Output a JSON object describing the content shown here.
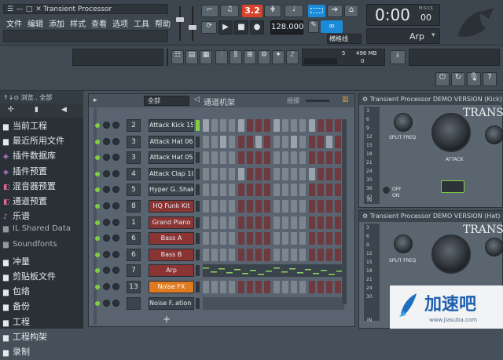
{
  "window": {
    "title": "Transient Processor",
    "buttons": [
      "☰",
      "—",
      "□",
      "✕"
    ]
  },
  "menu": [
    "文件",
    "编辑",
    "添加",
    "样式",
    "查看",
    "选项",
    "工具",
    "帮助"
  ],
  "transport": {
    "pattern_number": "3.2",
    "tempo": "128.000",
    "time": "0:00",
    "time_small": "00",
    "time_unit": "M:S:CS",
    "instrument": "Arp",
    "snap": "横格线"
  },
  "monitor": {
    "value": "5",
    "memory": "496 MB",
    "cpu": "0"
  },
  "browser": {
    "header": "浏览.. 全部",
    "items": [
      {
        "icon": "folder-icon",
        "label": "当前工程",
        "type": "folder"
      },
      {
        "icon": "folder-icon",
        "label": "最近所用文件",
        "type": "folder"
      },
      {
        "icon": "plugin-icon",
        "label": "插件数据库",
        "type": "plugin"
      },
      {
        "icon": "plugin-icon",
        "label": "插件预置",
        "type": "plugin"
      },
      {
        "icon": "mixer-icon",
        "label": "混音器预置",
        "type": "mixer"
      },
      {
        "icon": "channel-icon",
        "label": "通道预置",
        "type": "channel"
      },
      {
        "icon": "note-icon",
        "label": "乐谱",
        "type": "note"
      },
      {
        "icon": "folder-icon",
        "label": "IL Shared Data",
        "type": "folder-dim"
      },
      {
        "icon": "folder-icon",
        "label": "Soundfonts",
        "type": "folder-dim"
      },
      {
        "icon": "folder-icon",
        "label": "冲量",
        "type": "folder"
      },
      {
        "icon": "folder-icon",
        "label": "剪贴板文件",
        "type": "folder"
      },
      {
        "icon": "folder-icon",
        "label": "包络",
        "type": "folder"
      },
      {
        "icon": "folder-icon",
        "label": "备份",
        "type": "folder"
      },
      {
        "icon": "folder-icon",
        "label": "工程",
        "type": "folder"
      },
      {
        "icon": "folder-icon",
        "label": "工程构架",
        "type": "folder"
      },
      {
        "icon": "folder-icon",
        "label": "录制",
        "type": "folder"
      }
    ]
  },
  "channel_rack": {
    "filter": "全部",
    "title": "通道机架",
    "swing_label": "摇摆",
    "add_label": "+",
    "channels": [
      {
        "num": "2",
        "name": "Attack Kick 15",
        "style": "normal",
        "steps": [
          1,
          0,
          0,
          0,
          1,
          0,
          0,
          0,
          1,
          0,
          0,
          0,
          1,
          0,
          0,
          0
        ]
      },
      {
        "num": "3",
        "name": "Attack Hat 06",
        "style": "normal",
        "steps": [
          0,
          0,
          1,
          0,
          0,
          0,
          1,
          0,
          0,
          0,
          1,
          0,
          0,
          0,
          1,
          0
        ]
      },
      {
        "num": "3",
        "name": "Attack Hat 05",
        "style": "normal",
        "steps": [
          0,
          0,
          0,
          0,
          0,
          0,
          0,
          0,
          0,
          0,
          0,
          0,
          0,
          0,
          0,
          0
        ]
      },
      {
        "num": "4",
        "name": "Attack Clap 10",
        "style": "normal",
        "steps": [
          0,
          0,
          0,
          0,
          1,
          0,
          0,
          0,
          0,
          0,
          0,
          0,
          1,
          0,
          0,
          0
        ]
      },
      {
        "num": "5",
        "name": "Hyper G..Shaker",
        "style": "normal",
        "steps": [
          0,
          0,
          0,
          0,
          0,
          0,
          0,
          0,
          0,
          0,
          0,
          0,
          0,
          0,
          0,
          0
        ]
      },
      {
        "num": "8",
        "name": "HQ Funk Kit",
        "style": "red",
        "steps": [
          0,
          0,
          0,
          0,
          0,
          0,
          0,
          0,
          0,
          0,
          0,
          0,
          0,
          0,
          0,
          0
        ]
      },
      {
        "num": "1",
        "name": "Grand Piano",
        "style": "red",
        "steps": [
          0,
          0,
          0,
          0,
          0,
          0,
          0,
          0,
          0,
          0,
          0,
          0,
          0,
          0,
          0,
          0
        ]
      },
      {
        "num": "6",
        "name": "Bass A",
        "style": "red",
        "steps": [
          0,
          0,
          0,
          0,
          0,
          0,
          0,
          0,
          0,
          0,
          0,
          0,
          0,
          0,
          0,
          0
        ]
      },
      {
        "num": "6",
        "name": "Bass B",
        "style": "red",
        "steps": [
          0,
          0,
          0,
          0,
          0,
          0,
          0,
          0,
          0,
          0,
          0,
          0,
          0,
          0,
          0,
          0
        ]
      },
      {
        "num": "7",
        "name": "Arp",
        "style": "red",
        "steps": []
      },
      {
        "num": "13",
        "name": "Noise FX",
        "style": "orange",
        "steps": [
          0,
          0,
          0,
          0,
          0,
          0,
          0,
          0,
          0,
          0,
          0,
          0,
          0,
          0,
          0,
          0
        ]
      },
      {
        "num": "",
        "name": "Noise F..ation X",
        "style": "normal",
        "steps": []
      }
    ]
  },
  "plugins": [
    {
      "title": "Transient Processor DEMO VERSION (Kick)",
      "brand": "TRANSIEN",
      "split_label": "SPLIT FREQ",
      "attack_label": "ATTACK",
      "off_label": "OFF",
      "on_label": "ON",
      "in_label": "IN",
      "meter_labels": [
        "3",
        "6",
        "9",
        "12",
        "15",
        "18",
        "21",
        "24",
        "30",
        "36",
        "42"
      ]
    },
    {
      "title": "Transient Processor DEMO VERSION (Hat)",
      "brand": "TRANSIEN",
      "split_label": "SPLIT FREQ",
      "attack_label": "",
      "off_label": "",
      "on_label": "",
      "in_label": "IN",
      "meter_labels": [
        "3",
        "6",
        "9",
        "12",
        "15",
        "18",
        "21",
        "24",
        "30"
      ]
    }
  ],
  "watermark": {
    "logo_text": "加速吧",
    "url": "www.jiasuba.com"
  },
  "colors": {
    "accent_blue": "#1b8ad8",
    "tempo_red": "#d9432b",
    "step_on_gray": "#9aa3ab",
    "step_red": "#6e3a3e",
    "step_gray": "#7d868e",
    "channel_orange": "#e07a20"
  }
}
